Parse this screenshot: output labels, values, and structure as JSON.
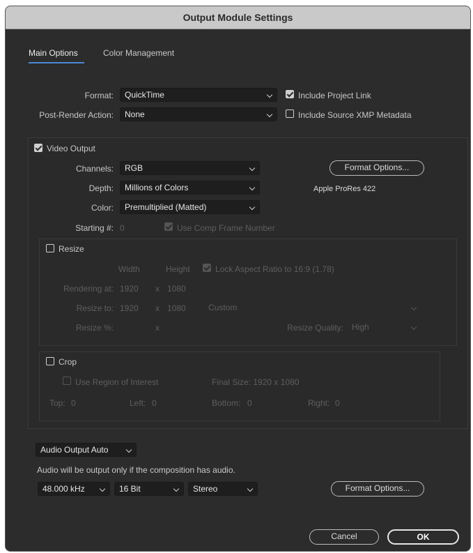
{
  "dialog": {
    "title": "Output Module Settings"
  },
  "tabs": [
    {
      "label": "Main Options",
      "active": true
    },
    {
      "label": "Color Management",
      "active": false
    }
  ],
  "format": {
    "format_label": "Format:",
    "format_value": "QuickTime",
    "post_render_label": "Post-Render Action:",
    "post_render_value": "None",
    "include_project_link": "Include Project Link",
    "include_project_link_checked": true,
    "include_source_xmp": "Include Source XMP Metadata",
    "include_source_xmp_checked": false
  },
  "video": {
    "video_output_label": "Video Output",
    "video_output_checked": true,
    "channels_label": "Channels:",
    "channels_value": "RGB",
    "depth_label": "Depth:",
    "depth_value": "Millions of Colors",
    "color_label": "Color:",
    "color_value": "Premultiplied (Matted)",
    "starting_label": "Starting #:",
    "starting_value": "0",
    "use_comp_frame": "Use Comp Frame Number",
    "use_comp_frame_checked": true,
    "format_options_button": "Format Options...",
    "codec_label": "Apple ProRes 422"
  },
  "resize": {
    "resize_label": "Resize",
    "resize_checked": false,
    "width_header": "Width",
    "height_header": "Height",
    "lock_aspect": "Lock Aspect Ratio to 16:9 (1.78)",
    "lock_aspect_checked": true,
    "rendering_at_label": "Rendering at:",
    "rendering_w": "1920",
    "rendering_x": "x",
    "rendering_h": "1080",
    "resize_to_label": "Resize to:",
    "resize_to_w": "1920",
    "resize_to_x": "x",
    "resize_to_h": "1080",
    "resize_preset": "Custom",
    "resize_pct_label": "Resize %:",
    "resize_pct_x": "x",
    "resize_quality_label": "Resize Quality:",
    "resize_quality_value": "High"
  },
  "crop": {
    "crop_label": "Crop",
    "crop_checked": false,
    "use_roi": "Use Region of Interest",
    "final_size": "Final Size: 1920 x 1080",
    "top_label": "Top:",
    "top_value": "0",
    "left_label": "Left:",
    "left_value": "0",
    "bottom_label": "Bottom:",
    "bottom_value": "0",
    "right_label": "Right:",
    "right_value": "0"
  },
  "audio": {
    "audio_output_value": "Audio Output Auto",
    "note": "Audio will be output only if the composition has audio.",
    "sample_rate": "48.000 kHz",
    "bit_depth": "16 Bit",
    "channels": "Stereo",
    "format_options_button": "Format Options..."
  },
  "footer": {
    "cancel_button": "Cancel",
    "ok_button": "OK"
  }
}
